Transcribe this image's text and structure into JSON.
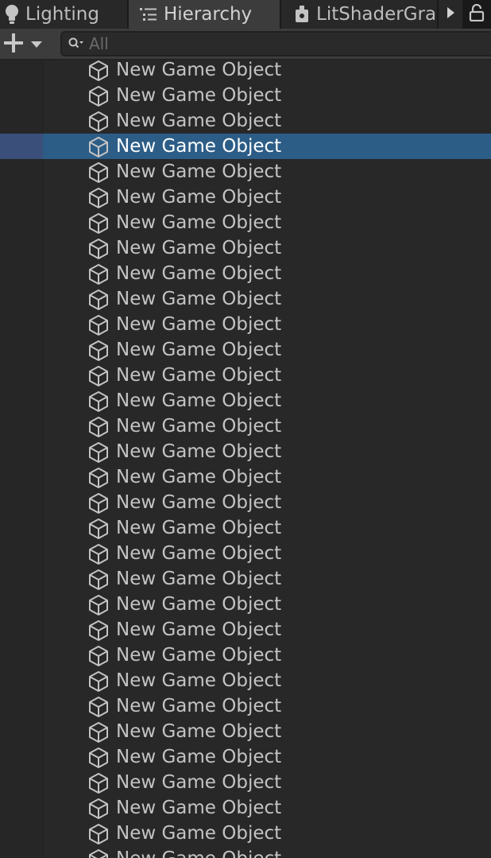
{
  "tabs": [
    {
      "label": "Lighting",
      "icon": "lightbulb-icon"
    },
    {
      "label": "Hierarchy",
      "icon": "list-icon"
    },
    {
      "label": "LitShaderGra",
      "icon": "shader-graph-icon"
    }
  ],
  "toolbar": {
    "search_placeholder": "All"
  },
  "hierarchy": {
    "item_label": "New Game Object",
    "item_icon": "cube-icon",
    "selected_index": 3,
    "items": [
      "New Game Object",
      "New Game Object",
      "New Game Object",
      "New Game Object",
      "New Game Object",
      "New Game Object",
      "New Game Object",
      "New Game Object",
      "New Game Object",
      "New Game Object",
      "New Game Object",
      "New Game Object",
      "New Game Object",
      "New Game Object",
      "New Game Object",
      "New Game Object",
      "New Game Object",
      "New Game Object",
      "New Game Object",
      "New Game Object",
      "New Game Object",
      "New Game Object",
      "New Game Object",
      "New Game Object",
      "New Game Object",
      "New Game Object",
      "New Game Object",
      "New Game Object",
      "New Game Object",
      "New Game Object",
      "New Game Object",
      "New Game Object"
    ]
  },
  "colors": {
    "background": "#282828",
    "selection": "#2c5d87",
    "text": "#c4c4c4"
  }
}
